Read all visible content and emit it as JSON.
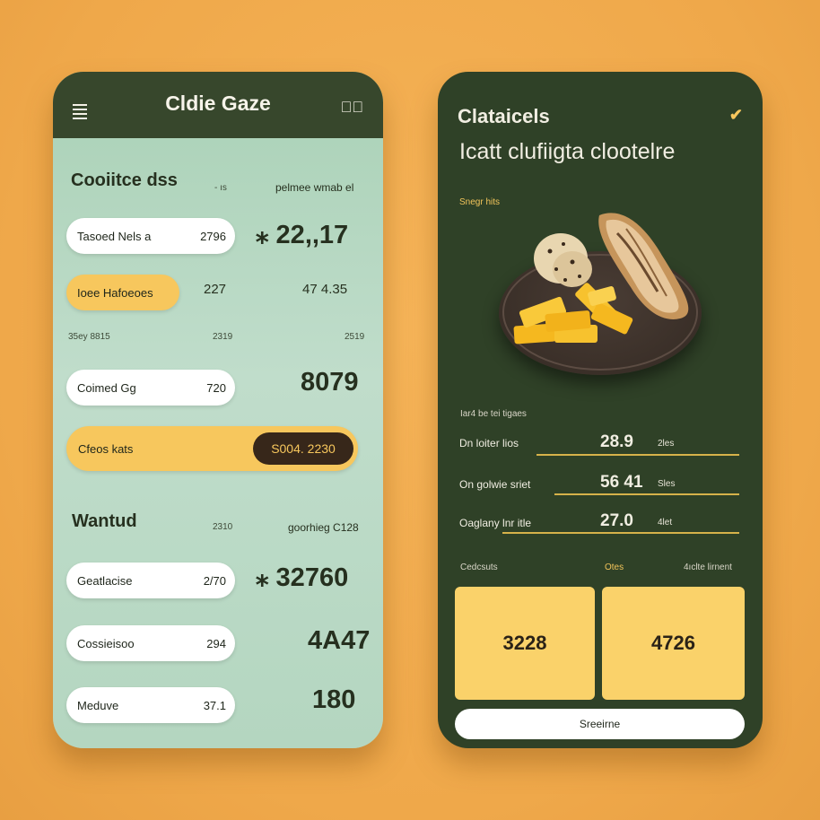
{
  "left": {
    "title": "Cldie Gaze",
    "section1": {
      "title": "Cooiitce dss",
      "meta": "- ıs",
      "meta_right": "pelmee wmab el"
    },
    "row1": {
      "label": "Tasoed Nels a",
      "value": "2796",
      "big": "⁎ 22,,17"
    },
    "row2": {
      "label": "Ioee Hafoeoes",
      "value": "227",
      "side": "47 4.35"
    },
    "caption": {
      "left": "35ey 8815",
      "mid": "2319",
      "right": "2519"
    },
    "row3": {
      "label": "Coimed Gg",
      "value": "720",
      "big": "8079"
    },
    "bar": {
      "label": "Cfeos kats",
      "chip": "S004. 2230"
    },
    "section2": {
      "title": "Wantud",
      "meta": "2310",
      "meta_right": "goorhieg C128"
    },
    "row4": {
      "label": "Geatlacise",
      "value": "2/70",
      "big": "⁎ 32760"
    },
    "row5": {
      "label": "Cossieisoo",
      "value": "294",
      "big": "4A47"
    },
    "row6": {
      "label": "Meduve",
      "value": "37.1",
      "big": "180"
    }
  },
  "right": {
    "title": "Clataicels",
    "subtitle": "Icatt clufiigta clootelre",
    "tag": "Snegr hits",
    "caption": "Iar4 be tei tigaes",
    "rows": [
      {
        "label": "Dn loiter lios",
        "value": "28.9",
        "unit": "2les"
      },
      {
        "label": "On golwie sriet",
        "value": "56 41",
        "unit": "Sles"
      },
      {
        "label": "Oaglany lnr itle",
        "value": "27.0",
        "unit": "4let"
      }
    ],
    "footer": {
      "left": "Cedcsuts",
      "mid": "Otes",
      "right": "4ıclte lirnent"
    },
    "tile_left": "3228",
    "tile_right": "4726",
    "button": "Sreeirne"
  },
  "icons": [
    "menu-icon",
    "close-icon",
    "check-chevron-icon",
    "food-plate-image"
  ],
  "colors": {
    "dark_green": "#37472c",
    "mint": "#b4d6c0",
    "accent_yellow": "#f7c75d",
    "background_orange": "#efa84a"
  }
}
